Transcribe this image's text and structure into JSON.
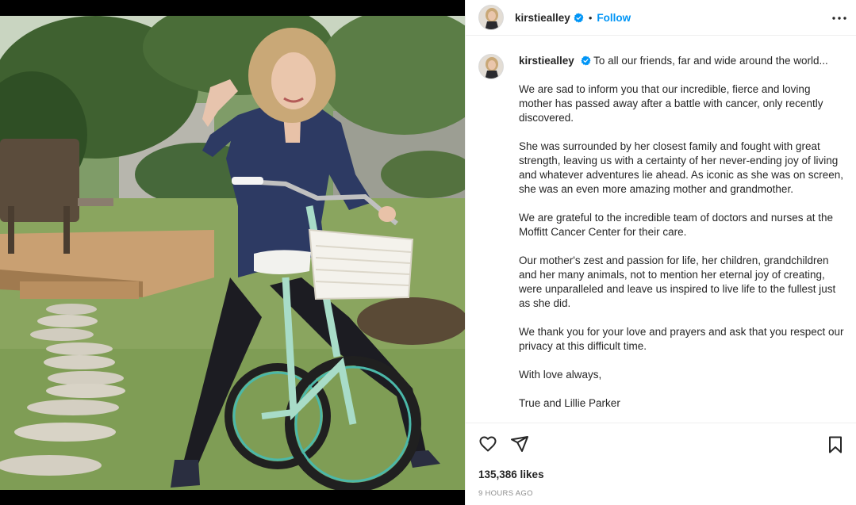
{
  "post": {
    "username": "kirstiealley",
    "follow_label": "Follow",
    "separator": "•",
    "photo_alt": "Woman posing on a mint-green bicycle with a white wicker basket in a garden"
  },
  "caption": {
    "username": "kirstiealley",
    "lead": "To all our friends, far and wide around the world...",
    "paragraphs": [
      "We are sad to inform you that our incredible, fierce and loving mother has passed away after a battle with cancer, only recently discovered.",
      "She was surrounded by her closest family and fought with great strength, leaving us with a certainty of her never-ending joy of living and whatever adventures lie ahead. As iconic as she was on screen, she was an even more amazing mother and grandmother.",
      "We are grateful to the incredible team of doctors and nurses at the Moffitt Cancer Center for their care.",
      "Our mother's zest and passion for life, her children, grandchildren and her many animals, not to mention her eternal joy of creating, were unparalleled and leave us inspired to live life to the fullest just as she did.",
      "We thank you for your love and prayers and ask that you respect our privacy at this difficult time.",
      "With love always,",
      "True and Lillie Parker"
    ]
  },
  "stats": {
    "likes": "135,386 likes",
    "time": "9 HOURS AGO"
  },
  "icons": {
    "verified": "verified-badge-icon",
    "more": "more-options-icon",
    "like": "heart-icon",
    "share": "paper-plane-icon",
    "save": "bookmark-icon"
  },
  "colors": {
    "accent": "#0095f6",
    "text": "#262626",
    "muted": "#8e8e8e",
    "border": "#efefef"
  }
}
